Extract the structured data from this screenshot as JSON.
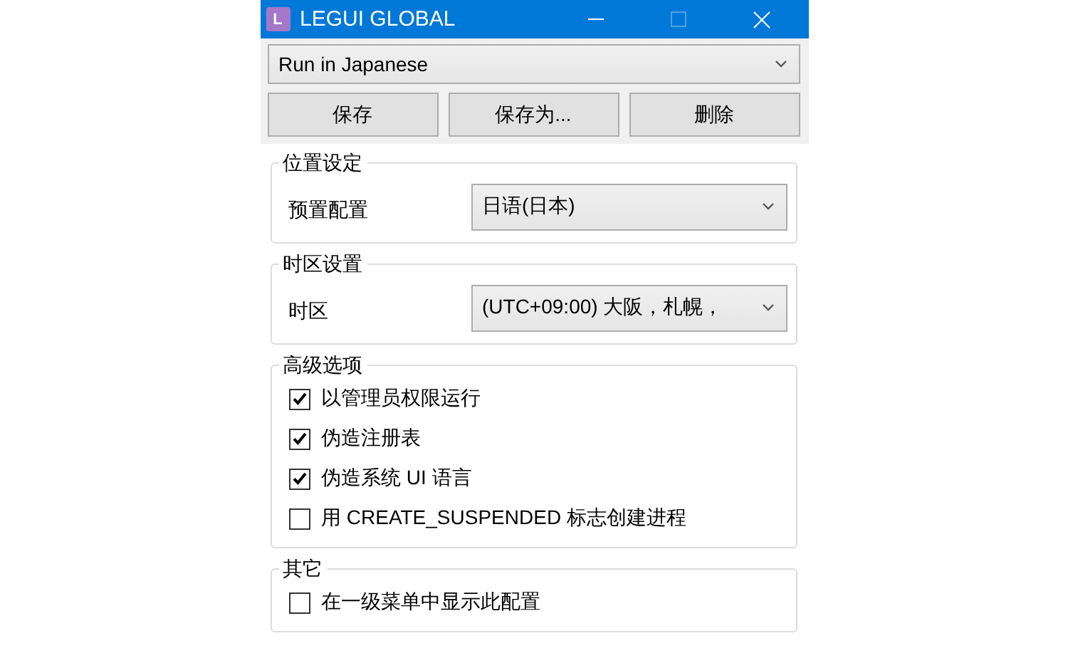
{
  "window": {
    "title": "LEGUI GLOBAL",
    "app_icon_letter": "L",
    "controls": [
      {
        "kind": "minimize",
        "disabled": false
      },
      {
        "kind": "maximize",
        "disabled": true
      },
      {
        "kind": "close",
        "disabled": false
      }
    ]
  },
  "profile_select": {
    "value": "Run in Japanese"
  },
  "buttons": [
    "保存",
    "保存为...",
    "删除"
  ],
  "groups": [
    {
      "title": "位置设定",
      "kind": "select",
      "label": "预置配置",
      "value": "日语(日本)"
    },
    {
      "title": "时区设置",
      "kind": "select",
      "label": "时区",
      "value": "(UTC+09:00) 大阪，札幌，"
    },
    {
      "title": "高级选项",
      "kind": "checks",
      "options": [
        {
          "label": "以管理员权限运行",
          "checked": true
        },
        {
          "label": "伪造注册表",
          "checked": true
        },
        {
          "label": "伪造系统 UI 语言",
          "checked": true
        },
        {
          "label": "用 CREATE_SUSPENDED 标志创建进程",
          "checked": false
        }
      ]
    },
    {
      "title": "其它",
      "kind": "checks",
      "options": [
        {
          "label": "在一级菜单中显示此配置",
          "checked": false
        }
      ]
    }
  ]
}
